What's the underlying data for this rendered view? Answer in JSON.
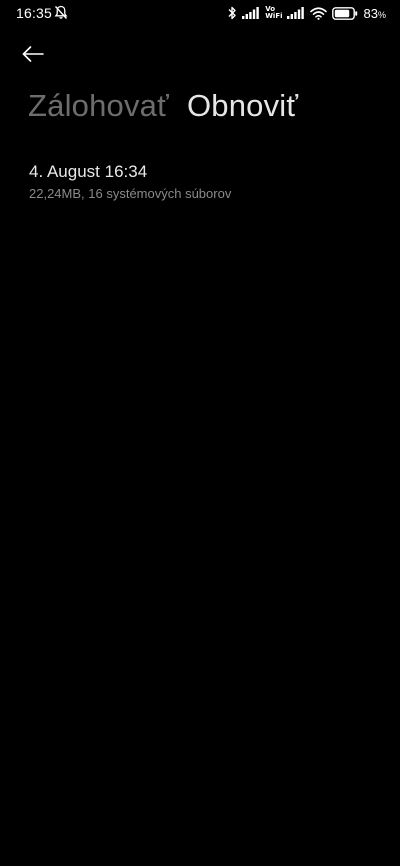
{
  "status_bar": {
    "time": "16:35",
    "vowifi_top": "Vo",
    "vowifi_bottom": "WiFi",
    "battery_percent": "83",
    "battery_level": 0.83
  },
  "header": {
    "back_icon": "arrow-left-icon"
  },
  "tabs": [
    {
      "label": "Zálohovať",
      "active": false
    },
    {
      "label": "Obnoviť",
      "active": true
    }
  ],
  "backups": [
    {
      "title": "4. August 16:34",
      "details": "22,24MB, 16 systémových súborov"
    }
  ],
  "colors": {
    "background": "#000000",
    "text_primary": "#e8e8e8",
    "text_secondary": "#8a8a8a",
    "tab_inactive": "#6d6d6d"
  }
}
